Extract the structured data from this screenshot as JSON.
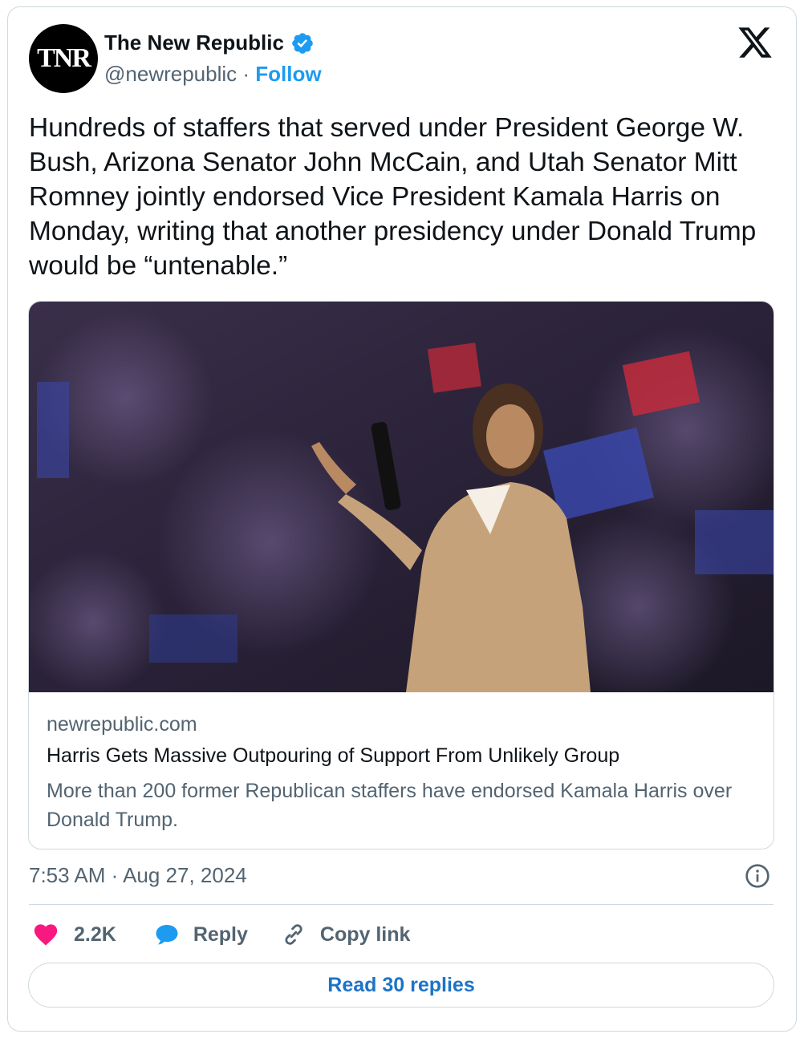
{
  "account": {
    "avatar_text": "TNR",
    "name": "The New Republic",
    "handle": "@newrepublic",
    "separator": " · ",
    "follow_label": "Follow"
  },
  "tweet": {
    "text": "Hundreds of staffers that served under President George W. Bush, Arizona Senator John McCain, and Utah Senator Mitt Romney jointly endorsed Vice President Kamala Harris on Monday, writing that another presidency under Donald Trump would be “untenable.”",
    "timestamp": "7:53 AM · Aug 27, 2024"
  },
  "link_card": {
    "domain": "newrepublic.com",
    "headline": "Harris Gets Massive Outpouring of Support From Unlikely Group",
    "description": "More than 200 former Republican staffers have endorsed Kamala Harris over Donald Trump."
  },
  "actions": {
    "like_count": "2.2K",
    "reply_label": "Reply",
    "copy_link_label": "Copy link"
  },
  "read_replies_label": "Read 30 replies",
  "icons": {
    "verified": "verified-badge-icon",
    "brand": "x-logo-icon",
    "info": "info-icon",
    "like": "heart-icon",
    "reply": "speech-bubble-icon",
    "copy": "link-icon"
  },
  "colors": {
    "accent_blue": "#1d9bf0",
    "like_pink": "#f91880",
    "secondary_text": "#536471",
    "border": "#cfd9de"
  }
}
